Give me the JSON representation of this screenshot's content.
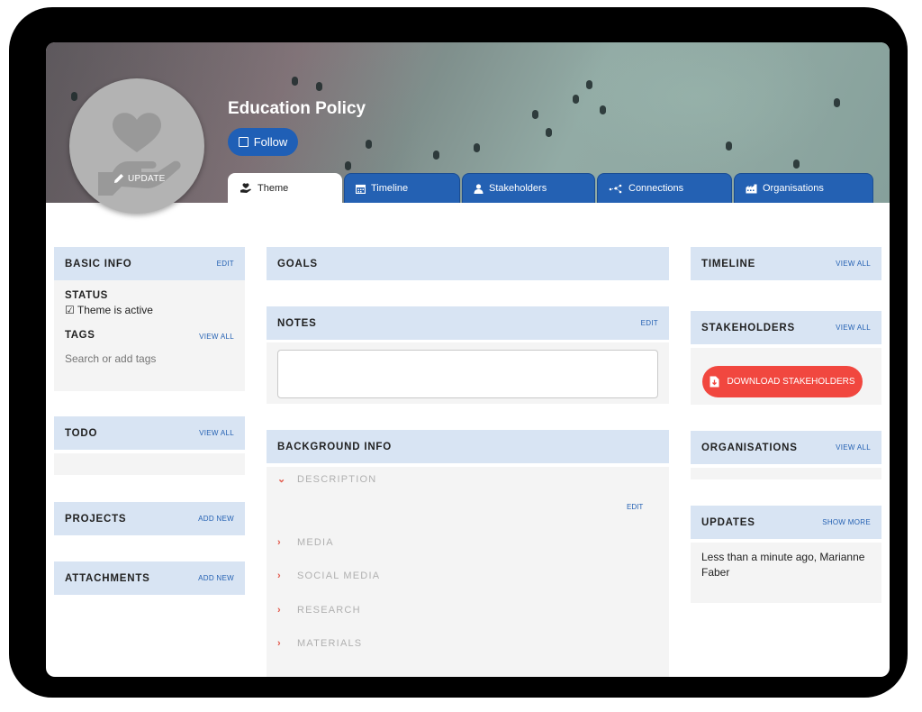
{
  "header": {
    "title": "Education Policy",
    "avatar_update_label": "UPDATE",
    "follow_label": "Follow"
  },
  "tabs": [
    {
      "label": "Theme",
      "icon": "hand-heart-icon",
      "active": true
    },
    {
      "label": "Timeline",
      "icon": "calendar-icon",
      "active": false
    },
    {
      "label": "Stakeholders",
      "icon": "user-icon",
      "active": false
    },
    {
      "label": "Connections",
      "icon": "network-icon",
      "active": false
    },
    {
      "label": "Organisations",
      "icon": "building-icon",
      "active": false
    }
  ],
  "left": {
    "basic_info": {
      "title": "BASIC INFO",
      "action": "EDIT"
    },
    "status_label": "STATUS",
    "status_value": "☑ Theme is active",
    "tags_label": "TAGS",
    "tags_action": "VIEW ALL",
    "tags_placeholder": "Search or add tags",
    "todo": {
      "title": "TODO",
      "action": "VIEW ALL"
    },
    "projects": {
      "title": "PROJECTS",
      "action": "ADD NEW"
    },
    "attachments": {
      "title": "ATTACHMENTS",
      "action": "ADD NEW"
    }
  },
  "center": {
    "goals": {
      "title": "GOALS"
    },
    "notes": {
      "title": "NOTES",
      "action": "EDIT"
    },
    "background": {
      "title": "BACKGROUND INFO"
    },
    "description_label": "DESCRIPTION",
    "description_edit": "EDIT",
    "sections": [
      "MEDIA",
      "SOCIAL MEDIA",
      "RESEARCH",
      "MATERIALS"
    ]
  },
  "right": {
    "timeline": {
      "title": "TIMELINE",
      "action": "VIEW ALL"
    },
    "stakeholders": {
      "title": "STAKEHOLDERS",
      "action": "VIEW ALL"
    },
    "download_label": "DOWNLOAD STAKEHOLDERS",
    "organisations": {
      "title": "ORGANISATIONS",
      "action": "VIEW ALL"
    },
    "updates": {
      "title": "UPDATES",
      "action": "SHOW MORE"
    },
    "update_text": "Less than a minute ago, Marianne Faber"
  },
  "colors": {
    "accent": "#2461b3",
    "header_bg": "#d8e4f3",
    "danger": "#f1473f"
  }
}
